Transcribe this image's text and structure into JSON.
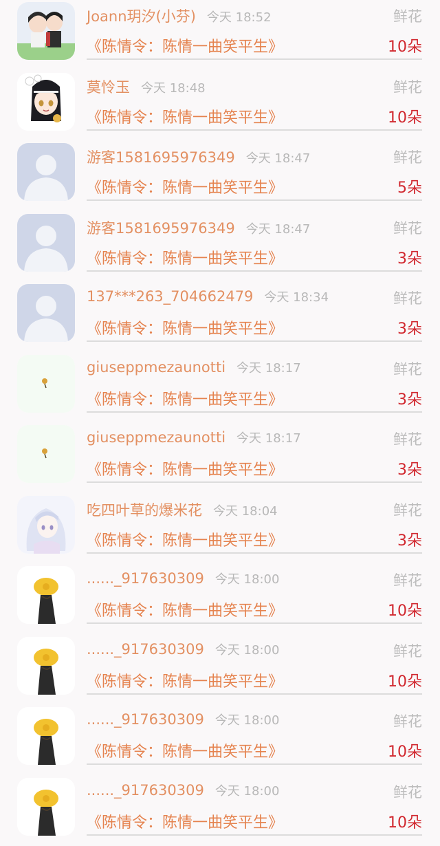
{
  "colors": {
    "name": "#e39062",
    "time": "#b8b8b8",
    "gift": "#bdbdbd",
    "title": "#e5834f",
    "count": "#d1282f",
    "divider": "#dcdcdc"
  },
  "rows": [
    {
      "name": "Joann玥汐(小芬)",
      "time": "今天 18:52",
      "gift": "鲜花",
      "title": "《陈情令：陈情一曲笑平生》",
      "count": "10朵",
      "avatar": "anime-couple-avatar"
    },
    {
      "name": "莫怜玉",
      "time": "今天 18:48",
      "gift": "鲜花",
      "title": "《陈情令：陈情一曲笑平生》",
      "count": "10朵",
      "avatar": "anime-chibi-avatar"
    },
    {
      "name": "游客1581695976349",
      "time": "今天 18:47",
      "gift": "鲜花",
      "title": "《陈情令：陈情一曲笑平生》",
      "count": "5朵",
      "avatar": "default-user-avatar"
    },
    {
      "name": "游客1581695976349",
      "time": "今天 18:47",
      "gift": "鲜花",
      "title": "《陈情令：陈情一曲笑平生》",
      "count": "3朵",
      "avatar": "default-user-avatar"
    },
    {
      "name": "137***263_704662479",
      "time": "今天 18:34",
      "gift": "鲜花",
      "title": "《陈情令：陈情一曲笑平生》",
      "count": "3朵",
      "avatar": "default-user-avatar"
    },
    {
      "name": "giuseppmezaunotti",
      "time": "今天 18:17",
      "gift": "鲜花",
      "title": "《陈情令：陈情一曲笑平生》",
      "count": "3朵",
      "avatar": "small-flower-avatar"
    },
    {
      "name": "giuseppmezaunotti",
      "time": "今天 18:17",
      "gift": "鲜花",
      "title": "《陈情令：陈情一曲笑平生》",
      "count": "3朵",
      "avatar": "small-flower-avatar"
    },
    {
      "name": "吃四叶草的爆米花",
      "time": "今天 18:04",
      "gift": "鲜花",
      "title": "《陈情令：陈情一曲笑平生》",
      "count": "3朵",
      "avatar": "anime-girl-avatar"
    },
    {
      "name": "......_917630309",
      "time": "今天 18:00",
      "gift": "鲜花",
      "title": "《陈情令：陈情一曲笑平生》",
      "count": "10朵",
      "avatar": "yellow-hat-avatar"
    },
    {
      "name": "......_917630309",
      "time": "今天 18:00",
      "gift": "鲜花",
      "title": "《陈情令：陈情一曲笑平生》",
      "count": "10朵",
      "avatar": "yellow-hat-avatar"
    },
    {
      "name": "......_917630309",
      "time": "今天 18:00",
      "gift": "鲜花",
      "title": "《陈情令：陈情一曲笑平生》",
      "count": "10朵",
      "avatar": "yellow-hat-avatar"
    },
    {
      "name": "......_917630309",
      "time": "今天 18:00",
      "gift": "鲜花",
      "title": "《陈情令：陈情一曲笑平生》",
      "count": "10朵",
      "avatar": "yellow-hat-avatar"
    }
  ]
}
